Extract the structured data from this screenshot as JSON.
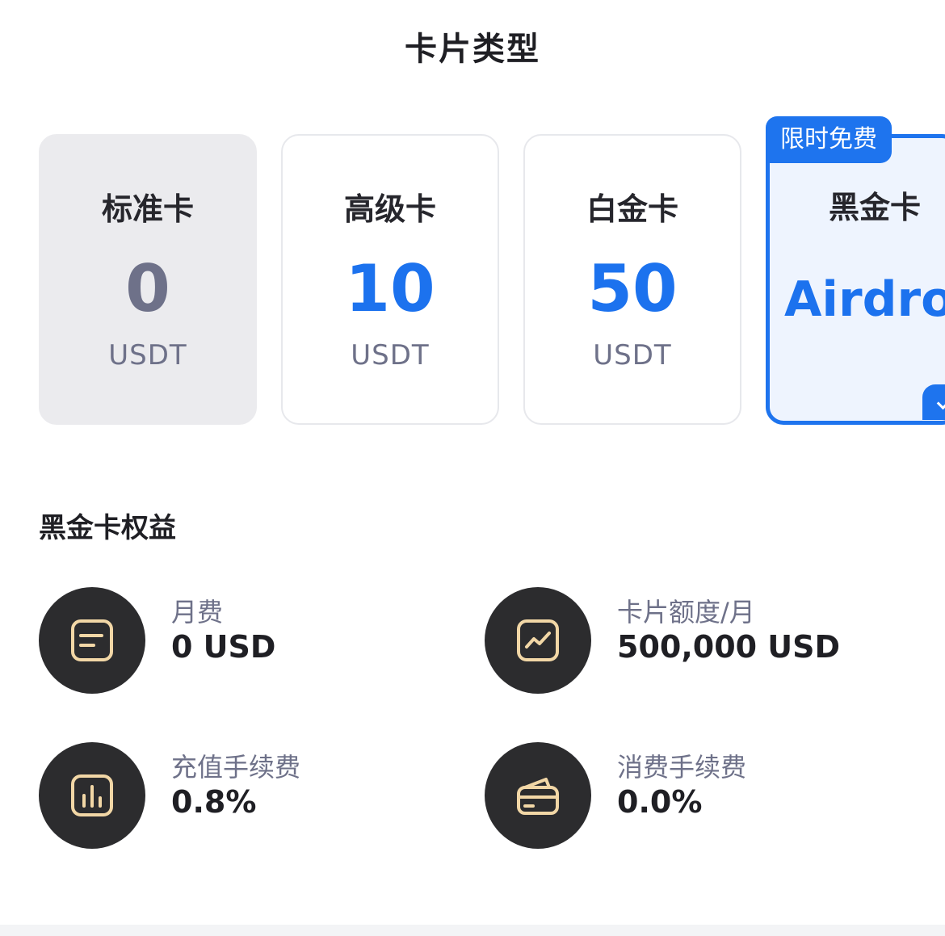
{
  "header": {
    "title": "卡片类型"
  },
  "cards": [
    {
      "name": "标准卡",
      "price": "0",
      "unit": "USDT"
    },
    {
      "name": "高级卡",
      "price": "10",
      "unit": "USDT"
    },
    {
      "name": "白金卡",
      "price": "50",
      "unit": "USDT"
    },
    {
      "name": "黑金卡",
      "price": "Airdrop",
      "badge": "限时免费"
    }
  ],
  "colors": {
    "accent": "#1e74ee",
    "selected_bg": "#ebebee",
    "icon_bg": "#2c2c2e",
    "icon_stroke": "#f2d7a6"
  },
  "benefits": {
    "title": "黑金卡权益",
    "items": [
      {
        "label": "月费",
        "value": "0 USD",
        "icon": "document-icon"
      },
      {
        "label": "卡片额度/月",
        "value": "500,000 USD",
        "icon": "trend-chart-icon"
      },
      {
        "label": "充值手续费",
        "value": "0.8%",
        "icon": "bar-chart-icon"
      },
      {
        "label": "消费手续费",
        "value": "0.0%",
        "icon": "wallet-card-icon"
      }
    ]
  }
}
